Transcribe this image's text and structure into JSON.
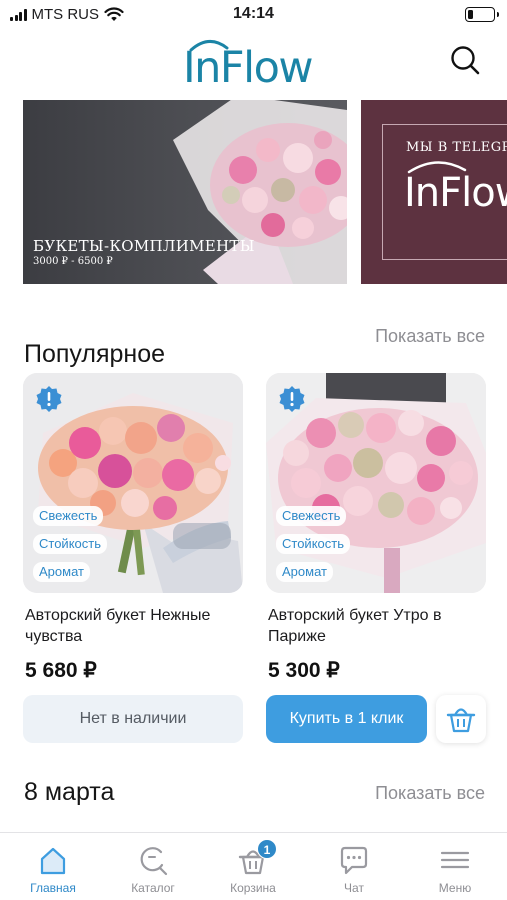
{
  "status_bar": {
    "carrier": "MTS RUS",
    "time": "14:14",
    "battery_level": 0.18
  },
  "header": {
    "logo_text": "InFlow"
  },
  "banners": [
    {
      "title": "БУКЕТЫ-КОМПЛИМЕНТЫ",
      "price": "3000 ₽ - 6500 ₽"
    },
    {
      "title": "МЫ В TELEGRAM",
      "logo_text": "InFlow"
    }
  ],
  "popular": {
    "title": "Популярное",
    "show_all": "Показать все",
    "products": [
      {
        "name": "Авторский букет Нежные чувства",
        "price": "5 680 ₽",
        "tags": [
          "Свежесть",
          "Стойкость",
          "Аромат"
        ],
        "button": "Нет в наличии",
        "in_stock": false
      },
      {
        "name": "Авторский букет Утро в Париже",
        "price": "5 300 ₽",
        "tags": [
          "Свежесть",
          "Стойкость",
          "Аромат"
        ],
        "button": "Купить в 1 клик",
        "in_stock": true
      }
    ]
  },
  "march8": {
    "title": "8 марта",
    "show_all": "Показать все"
  },
  "bottom_nav": {
    "items": [
      {
        "label": "Главная",
        "icon": "home-icon",
        "active": true
      },
      {
        "label": "Каталог",
        "icon": "catalog-search-icon",
        "active": false
      },
      {
        "label": "Корзина",
        "icon": "basket-icon",
        "active": false,
        "badge": "1"
      },
      {
        "label": "Чат",
        "icon": "chat-icon",
        "active": false
      },
      {
        "label": "Меню",
        "icon": "menu-icon",
        "active": false
      }
    ]
  },
  "colors": {
    "accent": "#3e9de0",
    "brand": "#1b84a6",
    "muted": "#8e8e93",
    "banner_wine": "#5d3240"
  }
}
